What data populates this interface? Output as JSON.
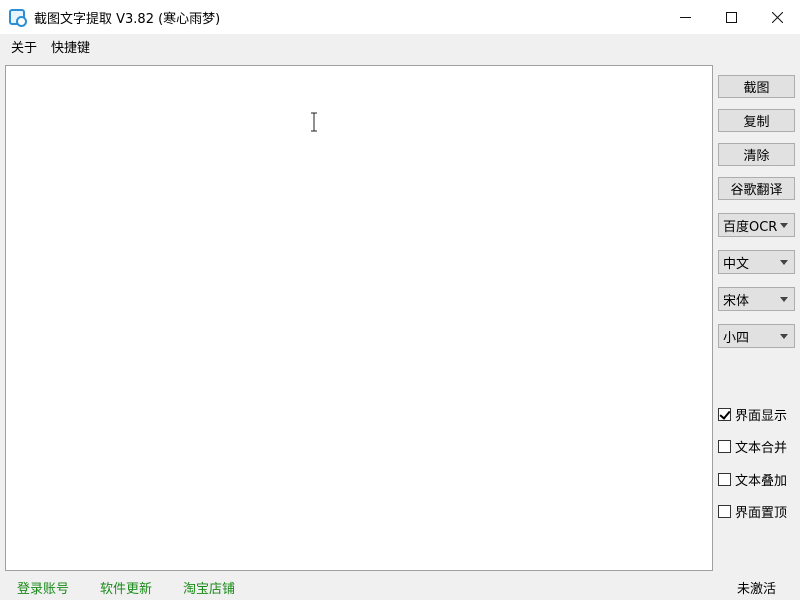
{
  "window": {
    "title": "截图文字提取 V3.82 (寒心雨梦)",
    "icon": "screenshot-ocr-app-icon",
    "controls": {
      "minimize_icon": "minimize-icon",
      "maximize_icon": "maximize-icon",
      "close_icon": "close-icon"
    }
  },
  "menubar": {
    "items": [
      {
        "label": "关于"
      },
      {
        "label": "快捷键"
      }
    ]
  },
  "editor": {
    "value": ""
  },
  "sidebar": {
    "buttons": {
      "screenshot": "截图",
      "copy": "复制",
      "clear": "清除",
      "translate": "谷歌翻译"
    },
    "dropdowns": {
      "ocr_engine": "百度OCR",
      "language": "中文",
      "font": "宋体",
      "font_size": "小四"
    },
    "checkboxes": [
      {
        "label": "界面显示",
        "checked": true
      },
      {
        "label": "文本合并",
        "checked": false
      },
      {
        "label": "文本叠加",
        "checked": false
      },
      {
        "label": "界面置顶",
        "checked": false
      }
    ]
  },
  "statusbar": {
    "links": {
      "login": "登录账号",
      "update": "软件更新",
      "shop": "淘宝店铺"
    },
    "activation": "未激活",
    "link_color": "#1a8a1a"
  }
}
